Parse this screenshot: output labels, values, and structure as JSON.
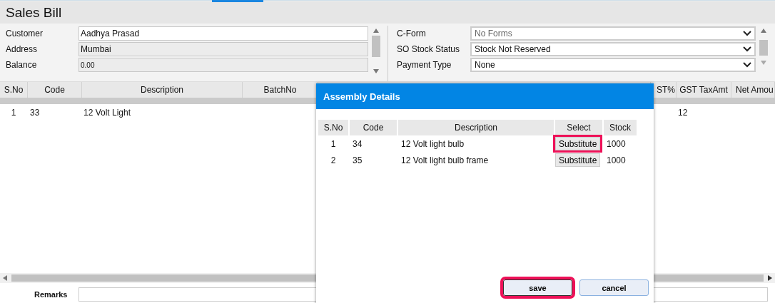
{
  "page": {
    "title": "Sales Bill"
  },
  "customer_fields": [
    {
      "label": "Customer",
      "value": "Aadhya Prasad",
      "readonly": false
    },
    {
      "label": "Address",
      "value": "Mumbai",
      "readonly": true
    },
    {
      "label": "Balance",
      "value": "0.00",
      "readonly": true
    }
  ],
  "options": [
    {
      "label": "C-Form",
      "value": "No Forms",
      "disabled": true
    },
    {
      "label": "SO Stock Status",
      "value": "Stock Not Reserved",
      "disabled": false
    },
    {
      "label": "Payment Type",
      "value": "None",
      "disabled": false
    }
  ],
  "table": {
    "columns_left": [
      "S.No",
      "Code",
      "Description",
      "BatchNo"
    ],
    "columns_right": [
      "ST%",
      "GST TaxAmt",
      "Net Amou"
    ],
    "rows": [
      {
        "sno": "1",
        "code": "33",
        "description": "12 Volt Light",
        "gst": "12"
      }
    ]
  },
  "footer": {
    "label": "Remarks"
  },
  "dialog": {
    "title": "Assembly Details",
    "columns": [
      "S.No",
      "Code",
      "Description",
      "Select",
      "Stock"
    ],
    "rows": [
      {
        "sno": "1",
        "code": "34",
        "description": "12 Volt light bulb",
        "action": "Substitute",
        "stock": "1000",
        "highlighted": true
      },
      {
        "sno": "2",
        "code": "35",
        "description": "12 Volt light bulb frame",
        "action": "Substitute",
        "stock": "1000",
        "highlighted": false
      }
    ],
    "buttons": [
      {
        "label": "save",
        "highlighted": true
      },
      {
        "label": "cancel",
        "highlighted": false
      }
    ]
  }
}
